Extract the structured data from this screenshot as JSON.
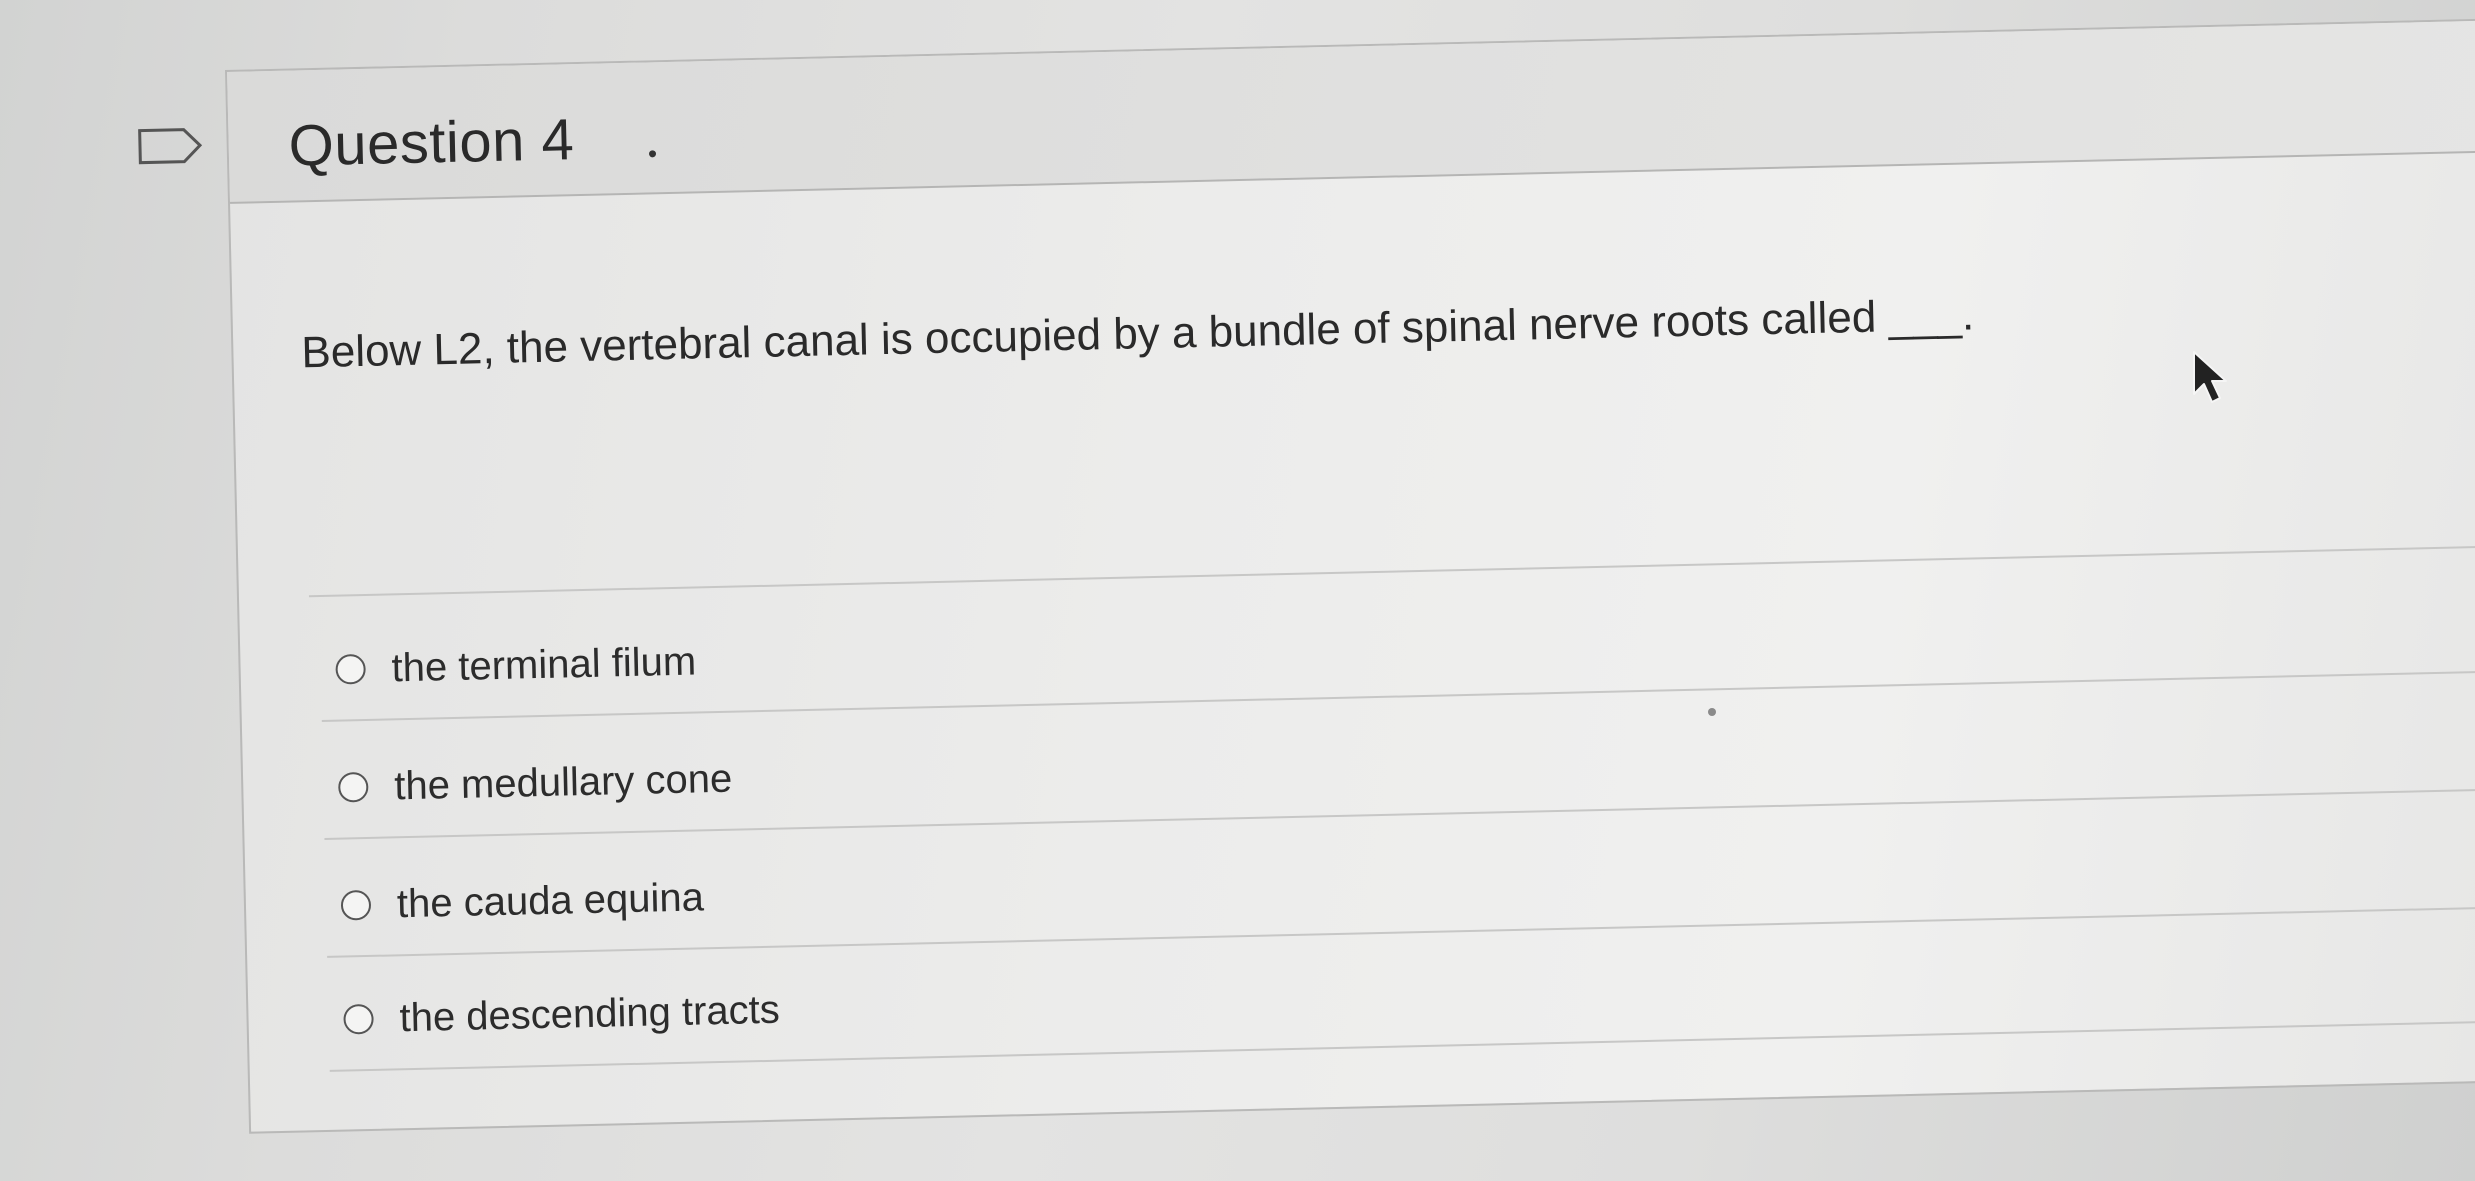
{
  "question": {
    "title": "Question 4",
    "text": "Below L2, the vertebral canal is occupied by a bundle of spinal nerve roots called ___."
  },
  "answers": [
    {
      "label": "the terminal filum",
      "selected": false
    },
    {
      "label": "the medullary cone",
      "selected": false
    },
    {
      "label": "the cauda equina",
      "selected": false
    },
    {
      "label": "the descending tracts",
      "selected": false
    }
  ],
  "icons": {
    "flag": "flag-outline-icon",
    "cursor": "mouse-pointer-icon"
  }
}
